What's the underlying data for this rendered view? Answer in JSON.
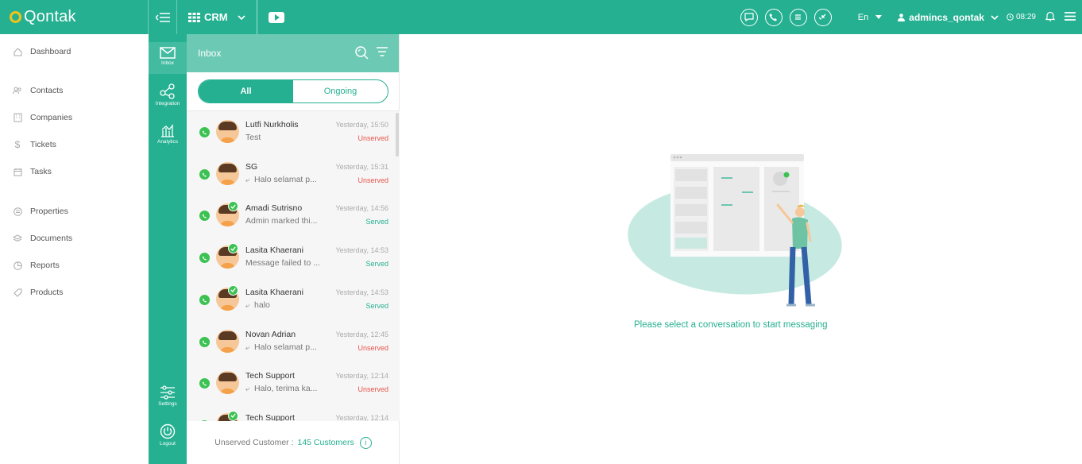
{
  "topbar": {
    "brand": "Qontak",
    "crm_label": "CRM",
    "lang": "En",
    "username": "admincs_qontak",
    "time": "08:29"
  },
  "sidebar": {
    "items": [
      {
        "label": "Dashboard",
        "icon": "home-icon"
      },
      {
        "label": "Contacts",
        "icon": "contacts-icon"
      },
      {
        "label": "Companies",
        "icon": "building-icon"
      },
      {
        "label": "Tickets",
        "icon": "dollar-icon"
      },
      {
        "label": "Tasks",
        "icon": "calendar-icon"
      },
      {
        "label": "Properties",
        "icon": "list-icon"
      },
      {
        "label": "Documents",
        "icon": "layers-icon"
      },
      {
        "label": "Reports",
        "icon": "pie-icon"
      },
      {
        "label": "Products",
        "icon": "tag-icon"
      }
    ]
  },
  "rail": {
    "inbox": "Inbox",
    "integration": "Integration",
    "analytics": "Analytics",
    "settings": "Settings",
    "logout": "Logout"
  },
  "inbox": {
    "title": "Inbox",
    "tab_all": "All",
    "tab_ongoing": "Ongoing",
    "conversations": [
      {
        "name": "Lutfi Nurkholis",
        "message": "Test",
        "date": "Yesterday, 15:50",
        "status": "Unserved",
        "reply": false,
        "checked": false
      },
      {
        "name": "SG",
        "message": "Halo selamat p...",
        "date": "Yesterday, 15:31",
        "status": "Unserved",
        "reply": true,
        "checked": false
      },
      {
        "name": "Amadi Sutrisno",
        "message": "Admin marked thi...",
        "date": "Yesterday, 14:56",
        "status": "Served",
        "reply": false,
        "checked": true
      },
      {
        "name": "Lasita Khaerani",
        "message": "Message failed to ...",
        "date": "Yesterday, 14:53",
        "status": "Served",
        "reply": false,
        "checked": true
      },
      {
        "name": "Lasita Khaerani",
        "message": "halo",
        "date": "Yesterday, 14:53",
        "status": "Served",
        "reply": true,
        "checked": true
      },
      {
        "name": "Novan Adrian",
        "message": "Halo selamat p...",
        "date": "Yesterday, 12:45",
        "status": "Unserved",
        "reply": true,
        "checked": false
      },
      {
        "name": "Tech Support",
        "message": "Halo, terima ka...",
        "date": "Yesterday, 12:14",
        "status": "Unserved",
        "reply": true,
        "checked": false
      },
      {
        "name": "Tech Support",
        "message": "",
        "date": "Yesterday, 12:14",
        "status": "",
        "reply": false,
        "checked": true
      }
    ],
    "footer_label": "Unserved Customer :",
    "footer_count": "145 Customers"
  },
  "main": {
    "empty_message": "Please select a conversation to start messaging"
  },
  "colors": {
    "primary": "#25b091",
    "header_light": "#6cc9b4",
    "unserved": "#e8534a",
    "whatsapp": "#3cc252"
  }
}
